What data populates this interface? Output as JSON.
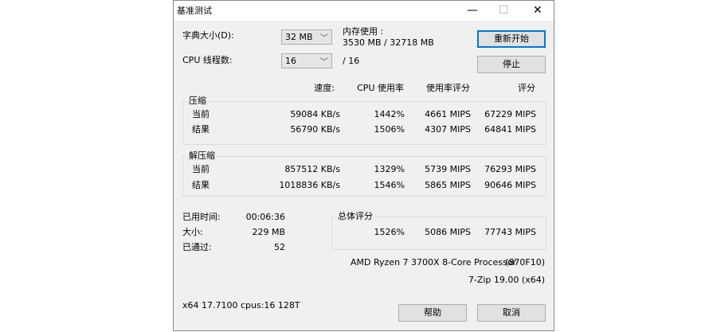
{
  "window": {
    "title": "基准测试",
    "min": "—",
    "max": "☐",
    "close": "✕"
  },
  "dict": {
    "label": "字典大小(D):",
    "value": "32 MB"
  },
  "threads": {
    "label": "CPU 线程数:",
    "value": "16",
    "max": "/ 16"
  },
  "memory": {
    "label": "内存使用 :",
    "value": "3530 MB / 32718 MB"
  },
  "buttons": {
    "restart": "重新开始",
    "stop": "停止",
    "help": "帮助",
    "cancel": "取消"
  },
  "headers": [
    "速度:",
    "CPU 使用率",
    "使用率评分",
    "评分"
  ],
  "compress": {
    "title": "压缩",
    "rows": [
      {
        "label": "当前",
        "speed": "59084 KB/s",
        "cpu": "1442%",
        "usage": "4661 MIPS",
        "rating": "67229 MIPS"
      },
      {
        "label": "结果",
        "speed": "56790 KB/s",
        "cpu": "1506%",
        "usage": "4307 MIPS",
        "rating": "64841 MIPS"
      }
    ]
  },
  "decompress": {
    "title": "解压缩",
    "rows": [
      {
        "label": "当前",
        "speed": "857512 KB/s",
        "cpu": "1329%",
        "usage": "5739 MIPS",
        "rating": "76293 MIPS"
      },
      {
        "label": "结果",
        "speed": "1018836 KB/s",
        "cpu": "1546%",
        "usage": "5865 MIPS",
        "rating": "90646 MIPS"
      }
    ]
  },
  "stats": {
    "elapsed_label": "已用时间:",
    "elapsed": "00:06:36",
    "size_label": "大小:",
    "size": "229 MB",
    "passes_label": "已通过:",
    "passes": "52"
  },
  "total": {
    "title": "总体评分",
    "cpu": "1526%",
    "usage": "5086 MIPS",
    "rating": "77743 MIPS"
  },
  "cpu_name": "AMD Ryzen 7 3700X 8-Core Processor",
  "cpu_id": "(870F10)",
  "version": "7-Zip 19.00 (x64)",
  "sysinfo": "x64 17.7100 cpus:16 128T"
}
